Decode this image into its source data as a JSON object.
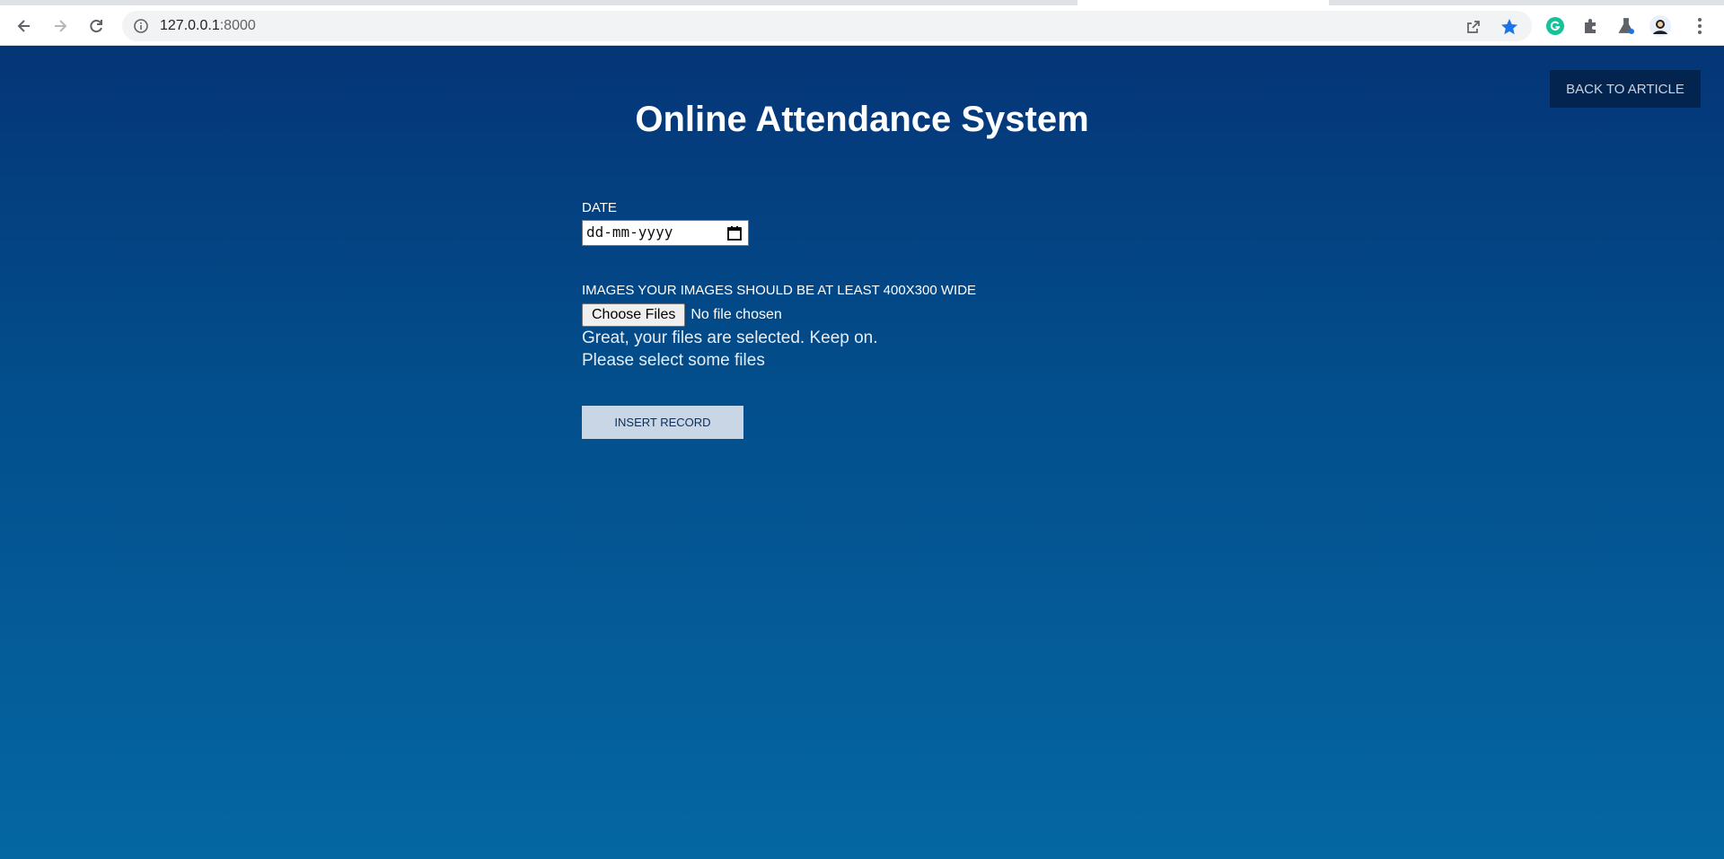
{
  "browser": {
    "url_host": "127.0.0.1",
    "url_port": ":8000",
    "icons": [
      "back-icon",
      "forward-icon",
      "reload-icon",
      "site-info-icon",
      "share-icon",
      "bookmark-star-icon",
      "grammarly-extension-icon",
      "extensions-puzzle-icon",
      "lab-flask-icon",
      "profile-avatar",
      "menu-kebab-icon"
    ],
    "accent": "#1a73e8"
  },
  "page": {
    "back_button": "BACK TO ARTICLE",
    "title": "Online Attendance System",
    "date_label": "DATE",
    "date_placeholder": "dd-mm-yyyy",
    "images_label": "IMAGES YOUR IMAGES SHOULD BE AT LEAST 400X300 WIDE",
    "choose_files": "Choose Files",
    "no_file": "No file chosen",
    "selected_msg": "Great, your files are selected. Keep on.",
    "select_prompt": "Please select some files",
    "insert_button": "INSERT RECORD",
    "colors": {
      "gradient_top": "#043577",
      "gradient_bottom": "#0467a2",
      "back_button_bg": "#03244f",
      "insert_button_bg": "#c8d6e5"
    }
  }
}
